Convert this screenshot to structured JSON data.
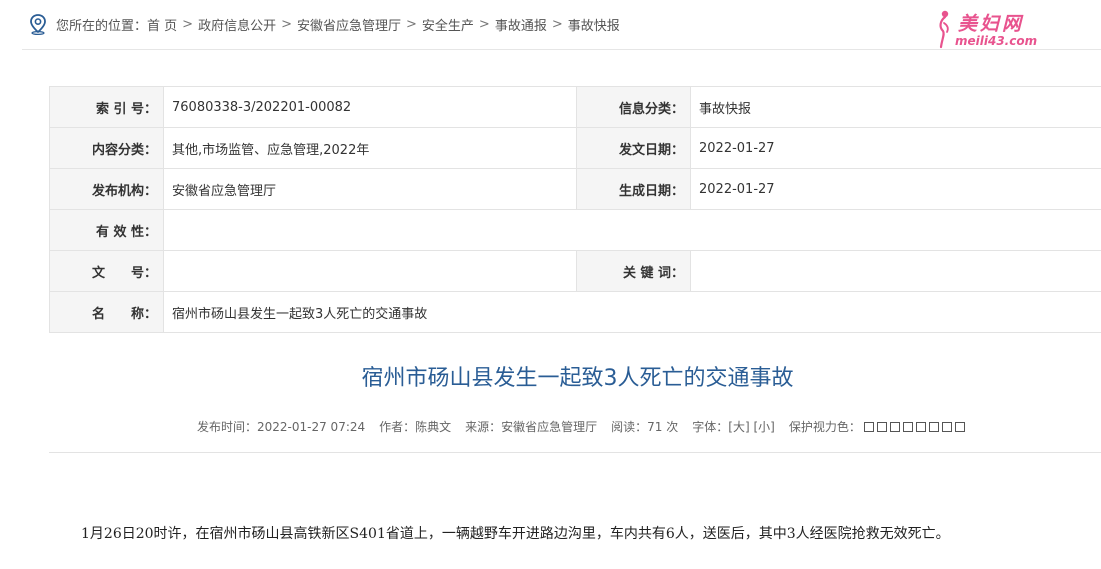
{
  "breadcrumb": {
    "prefix": "您所在的位置：",
    "items": [
      "首 页",
      "政府信息公开",
      "安徽省应急管理厅",
      "安全生产",
      "事故通报",
      "事故快报"
    ],
    "separator": ">"
  },
  "watermark": {
    "cn": "美妇网",
    "en": "meili43.com"
  },
  "info": {
    "index_label": "索 引 号：",
    "index_value": "76080338-3/202201-00082",
    "category_label": "信息分类：",
    "category_value": "事故快报",
    "content_label": "内容分类：",
    "content_value": "其他,市场监管、应急管理,2022年",
    "date_label": "发文日期：",
    "date_value": "2022-01-27",
    "org_label": "发布机构：",
    "org_value": "安徽省应急管理厅",
    "gen_label": "生成日期：",
    "gen_value": "2022-01-27",
    "validity_label": "有 效 性：",
    "validity_value": "",
    "docno_label": "文　　号：",
    "docno_value": "",
    "keyword_label": "关 键 词：",
    "keyword_value": "",
    "name_label": "名　　称：",
    "name_value": "宿州市砀山县发生一起致3人死亡的交通事故"
  },
  "article": {
    "title": "宿州市砀山县发生一起致3人死亡的交通事故",
    "meta": {
      "time": "发布时间：2022-01-27 07:24",
      "author": "作者：陈典文",
      "source": "来源：安徽省应急管理厅",
      "reads": "阅读：71 次",
      "font": "字体：[大] [小]",
      "eye": "保护视力色："
    },
    "swatch_colors": [
      "#ffffff",
      "#ffffff",
      "#ffffff",
      "#ffffff",
      "#ffffff",
      "#ffffff",
      "#ffffff",
      "#ffffff"
    ],
    "paragraph": "1月26日20时许，在宿州市砀山县高铁新区S401省道上，一辆越野车开进路边沟里，车内共有6人，送医后，其中3人经医院抢救无效死亡。"
  },
  "colors": {
    "title": "#2a5d95",
    "brand": "#e8538e",
    "label_bg": "#f5f5f5"
  }
}
